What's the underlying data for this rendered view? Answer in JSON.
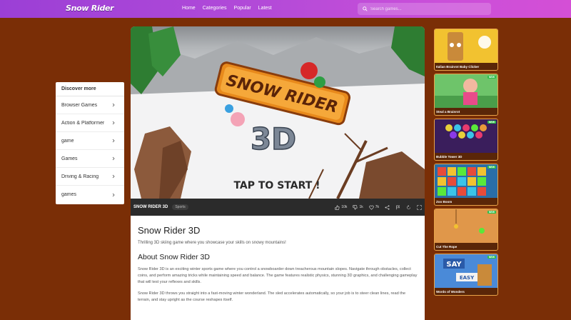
{
  "header": {
    "logo": "Snow Rider",
    "nav": [
      "Home",
      "Categories",
      "Popular",
      "Latest"
    ],
    "search_placeholder": "Search games..."
  },
  "sidebar": {
    "title": "Discover more",
    "items": [
      {
        "label": "Browser Games"
      },
      {
        "label": "Action & Platformer"
      },
      {
        "label": "game"
      },
      {
        "label": "Games"
      },
      {
        "label": "Driving & Racing"
      },
      {
        "label": "games"
      }
    ]
  },
  "game": {
    "logo_line1": "SNOW RIDER",
    "logo_line2": "3D",
    "prompt": "TAP TO START !",
    "bar_name": "SNOW RIDER 3D",
    "bar_tag": "Sports",
    "likes": "10k",
    "dislikes": "1k",
    "favorites": "7k"
  },
  "content": {
    "title": "Snow Rider 3D",
    "subtitle": "Thrilling 3D skiing game where you showcase your skills on snowy mountains!",
    "about_heading": "About Snow Rider 3D",
    "para1": "Snow Rider 3D is an exciting winter sports game where you control a snowboarder down treacherous mountain slopes. Navigate through obstacles, collect coins, and perform amazing tricks while maintaining speed and balance. The game features realistic physics, stunning 3D graphics, and challenging gameplay that will test your reflexes and skills.",
    "para2": "Snow Rider 3D throws you straight into a fast-moving winter wonderland. The sled accelerates automatically, so your job is to steer clean lines, read the terrain, and stay upright as the course reshapes itself."
  },
  "related": [
    {
      "title": "Italian Brainrot Baby Clicker",
      "new": false,
      "theme": "yellow"
    },
    {
      "title": "Steal a Brainrot",
      "new": true,
      "theme": "green"
    },
    {
      "title": "Bubble Tower 3D",
      "new": true,
      "theme": "purple"
    },
    {
      "title": "Zoo Boom",
      "new": true,
      "theme": "red"
    },
    {
      "title": "Cut The Rope",
      "new": true,
      "theme": "orange"
    },
    {
      "title": "Words of Wonders",
      "new": true,
      "theme": "blue"
    }
  ],
  "badge_new": "NEW",
  "colors": {
    "page_bg": "#7a2e06",
    "header_start": "#9b3fd6",
    "header_end": "#d44fd6",
    "accent_border": "#e8a44a"
  }
}
